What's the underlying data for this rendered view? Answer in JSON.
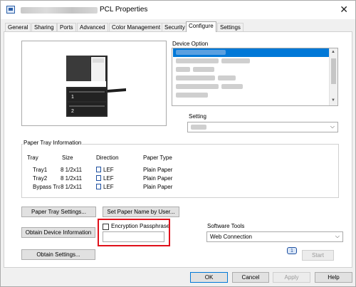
{
  "window": {
    "title": "PCL Properties",
    "title_icon": "printer-icon"
  },
  "tabs": [
    {
      "label": "General"
    },
    {
      "label": "Sharing"
    },
    {
      "label": "Ports"
    },
    {
      "label": "Advanced"
    },
    {
      "label": "Color Management"
    },
    {
      "label": "Security"
    },
    {
      "label": "Configure",
      "active": true
    },
    {
      "label": "Settings"
    }
  ],
  "device_option": {
    "label": "Device Option"
  },
  "setting": {
    "label": "Setting"
  },
  "paper_tray": {
    "label": "Paper Tray Information",
    "headers": [
      "Tray",
      "Size",
      "Direction",
      "Paper Type"
    ],
    "rows": [
      {
        "tray": "Tray1",
        "size": "8 1/2x11",
        "direction": "LEF",
        "type": "Plain Paper"
      },
      {
        "tray": "Tray2",
        "size": "8 1/2x11",
        "direction": "LEF",
        "type": "Plain Paper"
      },
      {
        "tray": "Bypass Tra",
        "size": "8 1/2x11",
        "direction": "LEF",
        "type": "Plain Paper"
      }
    ],
    "settings_button": "Paper Tray Settings...",
    "set_name_button": "Set Paper Name by User..."
  },
  "device_info": {
    "obtain_device_button": "Obtain Device Information",
    "obtain_settings_button": "Obtain Settings..."
  },
  "encryption": {
    "label": "Encryption Passphrase",
    "value": ""
  },
  "software_tools": {
    "label": "Software Tools",
    "selected": "Web Connection",
    "start_button": "Start"
  },
  "footer": {
    "ok": "OK",
    "cancel": "Cancel",
    "apply": "Apply",
    "help": "Help"
  },
  "colors": {
    "highlight": "#e0101a",
    "selection": "#0078d7"
  }
}
